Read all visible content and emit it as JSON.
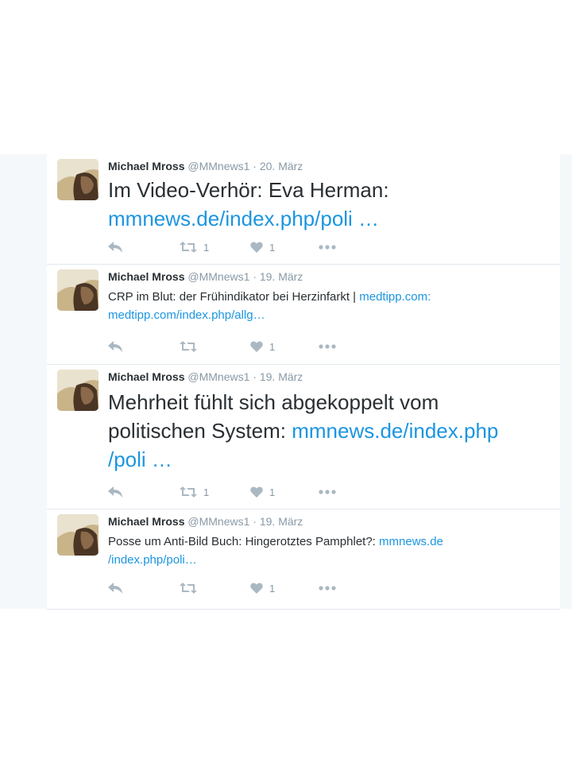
{
  "tweets": [
    {
      "name": "Michael Mross",
      "handle": "@MMnews1",
      "sep": "·",
      "date": "20. März",
      "lines": [
        {
          "text": "Im Video-Verhör: Eva Herman:",
          "link": ""
        },
        {
          "text": "",
          "link": "mmnews.de/index.php/poli  …"
        }
      ],
      "retweets": "1",
      "likes": "1"
    },
    {
      "name": "Michael Mross",
      "handle": "@MMnews1",
      "sep": "·",
      "date": "19. März",
      "lines": [
        {
          "text": "CRP im Blut: der Frühindikator bei Herzinfarkt | ",
          "link": "medtipp.com:"
        },
        {
          "text": "",
          "link": "medtipp.com/index.php/allg…"
        }
      ],
      "retweets": "",
      "likes": "1"
    },
    {
      "name": "Michael Mross",
      "handle": "@MMnews1",
      "sep": "·",
      "date": "19. März",
      "lines": [
        {
          "text": "Mehrheit fühlt sich abgekoppelt vom",
          "link": ""
        },
        {
          "text": "politischen System:  ",
          "link": "mmnews.de/index.php"
        },
        {
          "text": "",
          "link": "/poli  …"
        }
      ],
      "retweets": "1",
      "likes": "1"
    },
    {
      "name": "Michael Mross",
      "handle": "@MMnews1",
      "sep": "·",
      "date": "19. März",
      "lines": [
        {
          "text": "Posse um Anti-Bild Buch: Hingerotztes Pamphlet?: ",
          "link": "mmnews.de"
        },
        {
          "text": "",
          "link": "/index.php/poli…"
        }
      ],
      "retweets": "",
      "likes": "1"
    }
  ],
  "icons": {
    "reply": "reply-icon",
    "retweet": "retweet-icon",
    "like": "heart-icon",
    "more": "more-icon"
  },
  "colors": {
    "link": "#1b95e0",
    "text": "#292f33",
    "meta": "#8899a6",
    "icon": "#aab8c2",
    "background": "#f5f8fa"
  }
}
